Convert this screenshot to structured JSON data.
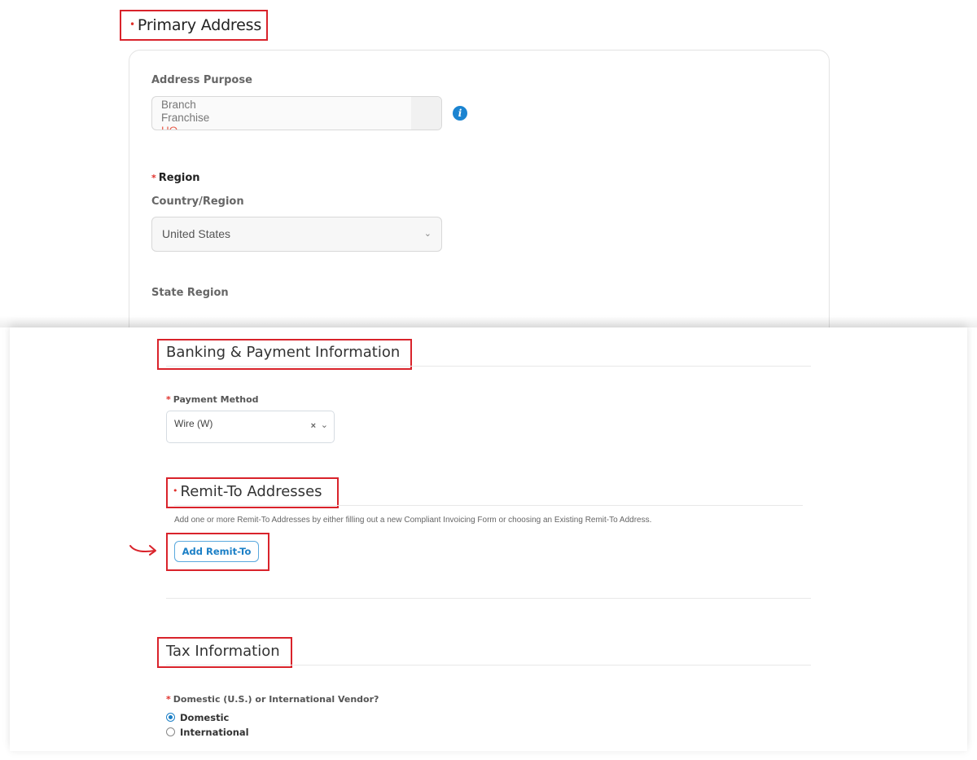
{
  "primary_address": {
    "title": "Primary Address",
    "required_marker": "•",
    "address_purpose": {
      "label": "Address Purpose",
      "options": [
        "Branch",
        "Franchise",
        "HQ"
      ],
      "selected": "HQ"
    },
    "info_icon": "i",
    "region": {
      "label": "Region",
      "required_marker": "*",
      "country_label": "Country/Region",
      "country_value": "United States",
      "state_label": "State Region"
    }
  },
  "banking": {
    "title": "Banking & Payment Information",
    "payment_method": {
      "label": "Payment Method",
      "required_marker": "*",
      "value": "Wire (W)",
      "clear_icon": "×",
      "chevron_icon": "⌄"
    }
  },
  "remit_to": {
    "title": "Remit-To Addresses",
    "required_marker": "•",
    "helper": "Add one or more Remit-To Addresses by either filling out a new Compliant Invoicing Form or choosing an Existing Remit-To Address.",
    "add_button": "Add Remit-To"
  },
  "tax": {
    "title": "Tax Information",
    "question": {
      "label": "Domestic (U.S.) or International Vendor?",
      "required_marker": "*",
      "options": [
        {
          "label": "Domestic",
          "checked": true
        },
        {
          "label": "International",
          "checked": false
        }
      ]
    }
  },
  "colors": {
    "highlight": "#d9232b",
    "accent": "#1b7fc6",
    "required": "#e0302b"
  }
}
